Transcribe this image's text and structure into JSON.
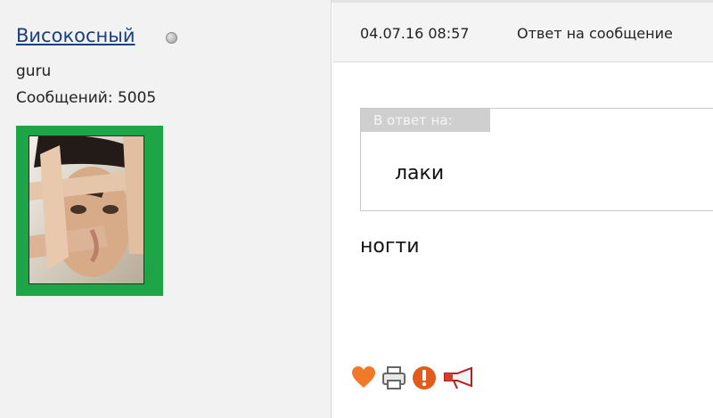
{
  "user": {
    "name": "Високосный",
    "rank": "guru",
    "posts_text": "Сообщений: 5005",
    "status_icon": "offline-status-dot",
    "avatar_frame_color": "#1ea548"
  },
  "post": {
    "date": "04.07.16 08:57",
    "reply_label": "Ответ на сообщение",
    "quote_label": "В ответ на:",
    "quote_text": "лаки",
    "message": "ногти"
  },
  "actions": [
    {
      "icon": "heart-icon",
      "color": "#f07a2a"
    },
    {
      "icon": "printer-icon",
      "color": "#777777"
    },
    {
      "icon": "warning-icon",
      "color": "#e25a1c"
    },
    {
      "icon": "megaphone-icon",
      "color": "#d73c2c"
    }
  ]
}
